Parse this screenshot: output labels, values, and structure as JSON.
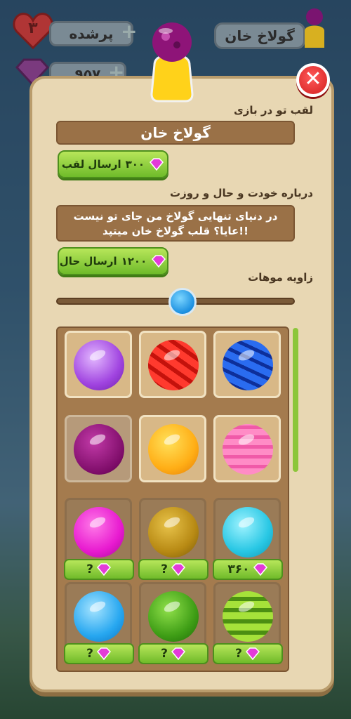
{
  "hud": {
    "lives": "۳",
    "lives_status": "پرشده",
    "gems": "۹۵۷",
    "player_name": "گولاخ خان"
  },
  "dialog": {
    "title_label": "لقب تو در بازی",
    "title_value": "گولاخ خان",
    "send_title_label": "ارسال لقب",
    "send_title_price": "۳۰۰",
    "about_label": "درباره خودت و حال و روزت",
    "about_text_line1": "در دنیای تنهایی گولاخ من جای تو نیست",
    "about_text_line2": "عایا؟ قلب گولاخ خان میتپد!!",
    "send_status_label": "ارسال حال",
    "send_status_price": "۱۲۰۰",
    "hair_angle_label": "زاویه موهات",
    "hair_angle_value": 0.53
  },
  "skins": [
    {
      "name": "purple-swirl",
      "price": null,
      "state": "owned"
    },
    {
      "name": "red-stripes",
      "price": null,
      "state": "owned"
    },
    {
      "name": "blue-waves",
      "price": null,
      "state": "owned"
    },
    {
      "name": "magenta-floral",
      "price": null,
      "state": "selected"
    },
    {
      "name": "orange-swirl",
      "price": null,
      "state": "owned"
    },
    {
      "name": "pink-waves",
      "price": null,
      "state": "owned"
    },
    {
      "name": "pink-dots",
      "price": "?",
      "state": "locked"
    },
    {
      "name": "gold-leopard",
      "price": "?",
      "state": "locked"
    },
    {
      "name": "cyan-spiral",
      "price": "۳۶۰",
      "state": "locked"
    },
    {
      "name": "sky-blue",
      "price": "?",
      "state": "locked"
    },
    {
      "name": "green-spots",
      "price": "?",
      "state": "locked"
    },
    {
      "name": "lime-stripes",
      "price": "?",
      "state": "locked"
    }
  ],
  "colors": {
    "panel": "#e8d7b3",
    "button_green": "#8cd23c",
    "close_red": "#e02a2a",
    "gem_pink": "#e33bd8"
  }
}
